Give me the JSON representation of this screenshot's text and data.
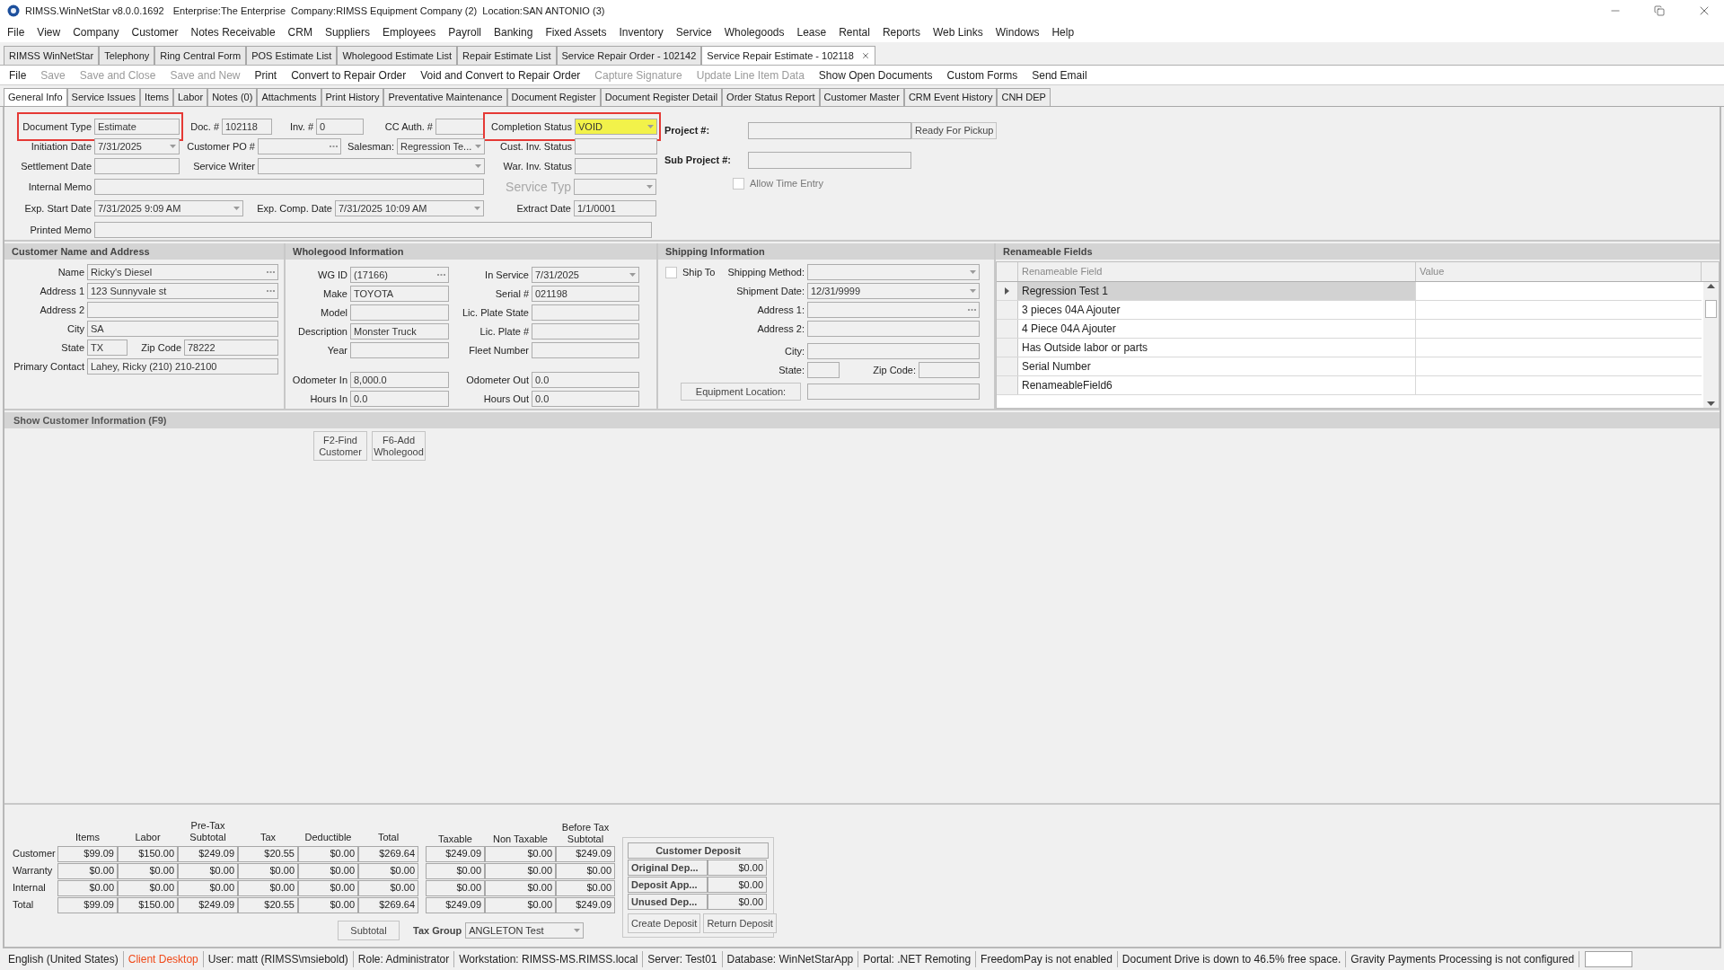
{
  "title_bar": {
    "app": "RIMSS.WinNetStar v8.0.0.1692",
    "enterprise": "Enterprise:The Enterprise",
    "company": "Company:RIMSS Equipment Company (2)",
    "location": "Location:SAN ANTONIO (3)"
  },
  "menu": [
    "File",
    "View",
    "Company",
    "Customer",
    "Notes Receivable",
    "CRM",
    "Suppliers",
    "Employees",
    "Payroll",
    "Banking",
    "Fixed Assets",
    "Inventory",
    "Service",
    "Wholegoods",
    "Lease",
    "Rental",
    "Reports",
    "Web Links",
    "Windows",
    "Help"
  ],
  "document_tabs": [
    {
      "label": "RIMSS WinNetStar",
      "selected": false,
      "closable": false
    },
    {
      "label": "Telephony",
      "selected": false,
      "closable": false
    },
    {
      "label": "Ring Central Form",
      "selected": false,
      "closable": false
    },
    {
      "label": "POS Estimate List",
      "selected": false,
      "closable": false
    },
    {
      "label": "Wholegood Estimate List",
      "selected": false,
      "closable": false
    },
    {
      "label": "Repair Estimate List",
      "selected": false,
      "closable": false
    },
    {
      "label": "Service Repair Order - 102142",
      "selected": false,
      "closable": false
    },
    {
      "label": "Service Repair Estimate - 102118",
      "selected": true,
      "closable": true
    }
  ],
  "toolbar": [
    {
      "label": "File",
      "disabled": false
    },
    {
      "label": "Save",
      "disabled": true
    },
    {
      "label": "Save and Close",
      "disabled": true
    },
    {
      "label": "Save and New",
      "disabled": true
    },
    {
      "label": "Print",
      "disabled": false
    },
    {
      "label": "Convert to Repair Order",
      "disabled": false
    },
    {
      "label": "Void and Convert to Repair Order",
      "disabled": false
    },
    {
      "label": "Capture Signature",
      "disabled": true
    },
    {
      "label": "Update Line Item Data",
      "disabled": true
    },
    {
      "label": "Show Open Documents",
      "disabled": false
    },
    {
      "label": "Custom Forms",
      "disabled": false
    },
    {
      "label": "Send Email",
      "disabled": false
    }
  ],
  "form_tabs": [
    {
      "label": "General Info",
      "selected": true
    },
    {
      "label": "Service Issues",
      "selected": false
    },
    {
      "label": "Items",
      "selected": false
    },
    {
      "label": "Labor",
      "selected": false
    },
    {
      "label": "Notes (0)",
      "selected": false
    },
    {
      "label": "Attachments",
      "selected": false
    },
    {
      "label": "Print History",
      "selected": false
    },
    {
      "label": "Preventative Maintenance",
      "selected": false
    },
    {
      "label": "Document Register",
      "selected": false
    },
    {
      "label": "Document Register Detail",
      "selected": false
    },
    {
      "label": "Order Status Report",
      "selected": false
    },
    {
      "label": "Customer Master",
      "selected": false
    },
    {
      "label": "CRM Event History",
      "selected": false
    },
    {
      "label": "CNH DEP",
      "selected": false
    }
  ],
  "header": {
    "fields": [
      {
        "label": "Document Type",
        "value": "Estimate",
        "kind": "text",
        "outlined": true,
        "highlighted": false,
        "disabled": false
      },
      {
        "label": "Doc. #",
        "value": "102118",
        "kind": "text",
        "outlined": false,
        "highlighted": false,
        "disabled": false
      },
      {
        "label": "Inv. #",
        "value": "0",
        "kind": "text",
        "outlined": false,
        "highlighted": false,
        "disabled": false
      },
      {
        "label": "CC Auth. #",
        "kind": "text",
        "outlined": false,
        "highlighted": false,
        "disabled": false
      },
      {
        "label": "Completion Status",
        "value": "VOID",
        "kind": "dropdown",
        "outlined": true,
        "highlighted": true,
        "disabled": false
      },
      {
        "label": "Initiation Date",
        "value": "7/31/2025",
        "kind": "dropdown",
        "outlined": false,
        "highlighted": false,
        "disabled": false
      },
      {
        "label": "Customer PO #",
        "kind": "lookup",
        "outlined": false,
        "highlighted": false,
        "disabled": false
      },
      {
        "label": "Salesman:",
        "value": "Regression Te...",
        "kind": "dropdown",
        "outlined": false,
        "highlighted": false,
        "disabled": false
      },
      {
        "label": "Cust. Inv. Status",
        "kind": "text",
        "outlined": false,
        "highlighted": false,
        "disabled": false
      },
      {
        "label": "Settlement Date",
        "kind": "text",
        "outlined": false,
        "highlighted": false,
        "disabled": false
      },
      {
        "label": "Service Writer",
        "kind": "dropdown",
        "outlined": false,
        "highlighted": false,
        "disabled": false
      },
      {
        "label": "War. Inv. Status",
        "kind": "text",
        "outlined": false,
        "highlighted": false,
        "disabled": false
      },
      {
        "label": "Internal Memo",
        "kind": "text",
        "outlined": false,
        "highlighted": false,
        "disabled": false
      },
      {
        "label": "Service Typ",
        "kind": "dropdown",
        "outlined": false,
        "highlighted": false,
        "disabled": true
      },
      {
        "label": "Exp. Start Date",
        "value": "7/31/2025 9:09 AM",
        "kind": "dropdown",
        "outlined": false,
        "highlighted": false,
        "disabled": false
      },
      {
        "label": "Exp. Comp. Date",
        "value": "7/31/2025 10:09 AM",
        "kind": "dropdown",
        "outlined": false,
        "highlighted": false,
        "disabled": false
      },
      {
        "label": "Extract Date",
        "value": "1/1/0001",
        "kind": "text",
        "outlined": false,
        "highlighted": false,
        "disabled": false
      },
      {
        "label": "Printed Memo",
        "kind": "text",
        "outlined": false,
        "highlighted": false,
        "disabled": false
      }
    ],
    "project": {
      "label": "Project #:",
      "button": "Ready For Pickup"
    },
    "sub_project": {
      "label": "Sub Project #:"
    },
    "allow_time_entry": {
      "label": "Allow Time Entry",
      "checked": false
    }
  },
  "customer": {
    "title": "Customer Name and Address",
    "fields": [
      {
        "label": "Name",
        "value": "Ricky's Diesel",
        "kind": "lookup"
      },
      {
        "label": "Address 1",
        "value": "123 Sunnyvale st",
        "kind": "lookup"
      },
      {
        "label": "Address 2",
        "kind": "text"
      },
      {
        "label": "City",
        "value": "SA",
        "kind": "text"
      },
      {
        "label": "State",
        "value": "TX",
        "kind": "text"
      },
      {
        "label": "Zip Code",
        "value": "78222",
        "kind": "text"
      },
      {
        "label": "Primary Contact",
        "value": "Lahey, Ricky (210) 210-2100",
        "kind": "text"
      }
    ]
  },
  "wholegood": {
    "title": "Wholegood Information",
    "fields": [
      {
        "label": "WG ID",
        "value": "(17166)",
        "kind": "lookup"
      },
      {
        "label": "In Service",
        "value": "7/31/2025",
        "kind": "dropdown"
      },
      {
        "label": "Make",
        "value": "TOYOTA",
        "kind": "text"
      },
      {
        "label": "Serial #",
        "value": "021198",
        "kind": "text"
      },
      {
        "label": "Model",
        "kind": "text"
      },
      {
        "label": "Lic. Plate State",
        "kind": "text"
      },
      {
        "label": "Description",
        "value": "Monster Truck",
        "kind": "text"
      },
      {
        "label": "Lic. Plate #",
        "kind": "text"
      },
      {
        "label": "Year",
        "kind": "text"
      },
      {
        "label": "Fleet Number",
        "kind": "text"
      },
      {
        "label": "Odometer In",
        "value": "8,000.0",
        "kind": "text"
      },
      {
        "label": "Odometer Out",
        "value": "0.0",
        "kind": "text"
      },
      {
        "label": "Hours In",
        "value": "0.0",
        "kind": "text"
      },
      {
        "label": "Hours Out",
        "value": "0.0",
        "kind": "text"
      }
    ]
  },
  "shipping": {
    "title": "Shipping Information",
    "ship_to": {
      "label": "Ship To",
      "checked": false
    },
    "fields": [
      {
        "label": "Shipping Method:",
        "kind": "dropdown"
      },
      {
        "label": "Shipment Date:",
        "value": "12/31/9999",
        "kind": "dropdown"
      },
      {
        "label": "Address 1:",
        "kind": "lookup"
      },
      {
        "label": "Address 2:",
        "kind": "text"
      },
      {
        "label": "City:",
        "kind": "text"
      },
      {
        "label": "State:",
        "kind": "text"
      },
      {
        "label": "Zip Code:",
        "kind": "text"
      }
    ],
    "equipment_location": {
      "button": "Equipment Location:"
    }
  },
  "renameable": {
    "title": "Renameable Fields",
    "columns": [
      "Renameable Field",
      "Value"
    ],
    "rows": [
      {
        "field": "Regression Test 1",
        "selected": true
      },
      {
        "field": "3 pieces 04A Ajouter",
        "selected": false
      },
      {
        "field": "4 Piece 04A Ajouter",
        "selected": false
      },
      {
        "field": "Has Outside labor or parts",
        "selected": false
      },
      {
        "field": "Serial Number",
        "selected": false
      },
      {
        "field": "RenameableField6",
        "selected": false
      }
    ]
  },
  "show_customer": {
    "title": "Show Customer Information (F9)",
    "buttons": [
      "F2-Find Customer",
      "F6-Add Wholegood"
    ]
  },
  "totals": {
    "columns": [
      "Items",
      "Labor",
      "Pre-Tax Subtotal",
      "Tax",
      "Deductible",
      "Total",
      "Taxable",
      "Non Taxable",
      "Before Tax Subtotal"
    ],
    "rows": [
      {
        "label": "Customer",
        "values": [
          "$99.09",
          "$150.00",
          "$249.09",
          "$20.55",
          "$0.00",
          "$269.64",
          "$249.09",
          "$0.00",
          "$249.09"
        ]
      },
      {
        "label": "Warranty",
        "values": [
          "$0.00",
          "$0.00",
          "$0.00",
          "$0.00",
          "$0.00",
          "$0.00",
          "$0.00",
          "$0.00",
          "$0.00"
        ]
      },
      {
        "label": "Internal",
        "values": [
          "$0.00",
          "$0.00",
          "$0.00",
          "$0.00",
          "$0.00",
          "$0.00",
          "$0.00",
          "$0.00",
          "$0.00"
        ]
      },
      {
        "label": "Total",
        "values": [
          "$99.09",
          "$150.00",
          "$249.09",
          "$20.55",
          "$0.00",
          "$269.64",
          "$249.09",
          "$0.00",
          "$249.09"
        ]
      }
    ],
    "subtotal_button": "Subtotal",
    "tax_group": {
      "label": "Tax Group",
      "value": "ANGLETON Test"
    }
  },
  "deposit": {
    "title": "Customer Deposit",
    "rows": [
      {
        "label": "Original Dep...",
        "value": "$0.00"
      },
      {
        "label": "Deposit App...",
        "value": "$0.00"
      },
      {
        "label": "Unused Dep...",
        "value": "$0.00"
      }
    ],
    "buttons": [
      "Create Deposit",
      "Return Deposit"
    ]
  },
  "status_bar": [
    {
      "text": "English (United States)",
      "highlight": false
    },
    {
      "text": "Client Desktop",
      "highlight": true
    },
    {
      "text": "User: matt (RIMSS\\msiebold)",
      "highlight": false
    },
    {
      "text": "Role: Administrator",
      "highlight": false
    },
    {
      "text": "Workstation: RIMSS-MS.RIMSS.local",
      "highlight": false
    },
    {
      "text": "Server: Test01",
      "highlight": false
    },
    {
      "text": "Database: WinNetStarApp",
      "highlight": false
    },
    {
      "text": "Portal: .NET Remoting",
      "highlight": false
    },
    {
      "text": "FreedomPay is not enabled",
      "highlight": false
    },
    {
      "text": "Document Drive is down to 46.5% free space.",
      "highlight": false
    },
    {
      "text": "Gravity Payments Processing is not configured",
      "highlight": false
    }
  ]
}
